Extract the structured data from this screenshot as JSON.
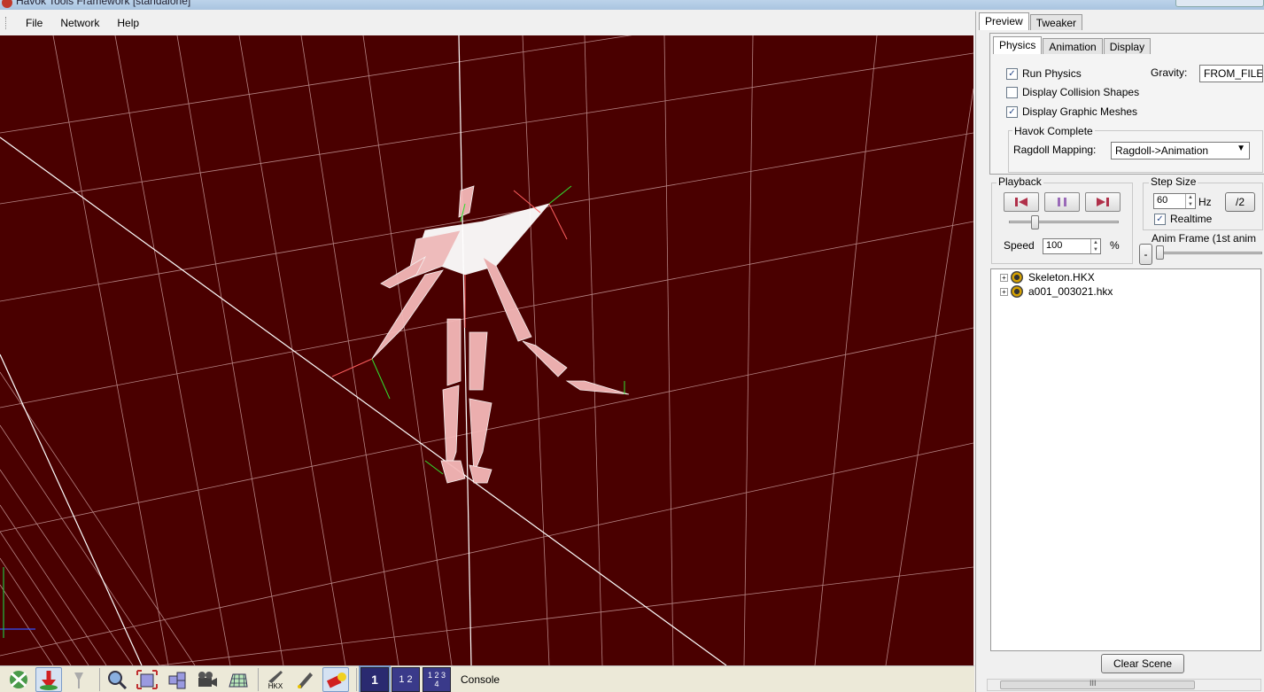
{
  "window": {
    "title": "Havok Tools Framework [standalone]"
  },
  "menu": {
    "items": [
      "File",
      "Network",
      "Help"
    ]
  },
  "toolbar": {
    "hkx_label": "HKX",
    "layout_buttons": [
      "1",
      "1 2",
      "1 2 3 4"
    ],
    "console_label": "Console"
  },
  "right_tabs": {
    "preview": "Preview",
    "tweaker": "Tweaker"
  },
  "sub_tabs": {
    "physics": "Physics",
    "animation": "Animation",
    "display": "Display"
  },
  "physics": {
    "run_physics": {
      "label": "Run Physics",
      "checked": true
    },
    "display_collision": {
      "label": "Display Collision Shapes",
      "checked": false
    },
    "display_meshes": {
      "label": "Display Graphic Meshes",
      "checked": true
    },
    "gravity_label": "Gravity:",
    "gravity_value": "FROM_FILE",
    "havok_complete_label": "Havok Complete",
    "ragdoll_mapping_label": "Ragdoll Mapping:",
    "ragdoll_mapping_value": "Ragdoll->Animation"
  },
  "playback": {
    "label": "Playback",
    "speed_label": "Speed",
    "speed_value": "100",
    "speed_unit": "%"
  },
  "step_size": {
    "label": "Step Size",
    "value": "60",
    "unit": "Hz",
    "half_button": "/2",
    "realtime_label": "Realtime",
    "realtime_checked": true
  },
  "anim_frame": {
    "label": "Anim Frame (1st anim",
    "minus_button": "-"
  },
  "scene_tree": {
    "items": [
      "Skeleton.HKX",
      "a001_003021.hkx"
    ]
  },
  "clear_scene_button": "Clear Scene",
  "scroll_grip": "III",
  "colors": {
    "viewport_bg": "#4a0000",
    "skeleton": "#f0b8b8",
    "grid": "#e8c8c8"
  }
}
